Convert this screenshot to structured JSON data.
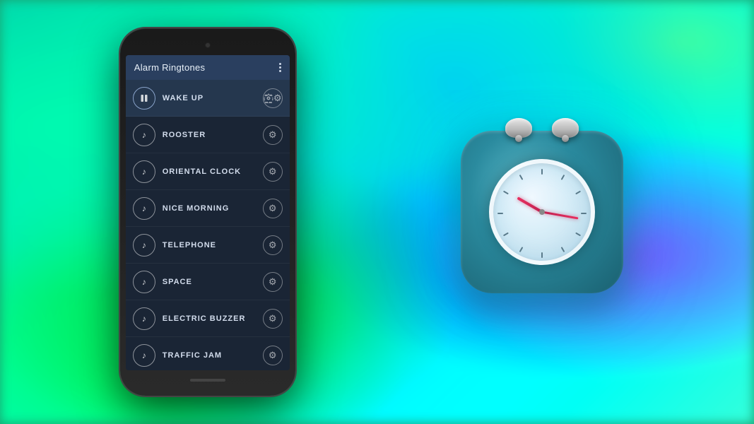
{
  "app": {
    "title": "Alarm Ringtones",
    "menu_dots_label": "more options"
  },
  "ringtones": [
    {
      "id": 1,
      "name": "WAKE UP",
      "playing": true
    },
    {
      "id": 2,
      "name": "ROOSTER",
      "playing": false
    },
    {
      "id": 3,
      "name": "ORIENTAL CLOCK",
      "playing": false
    },
    {
      "id": 4,
      "name": "NICE MORNING",
      "playing": false
    },
    {
      "id": 5,
      "name": "TELEPHONE",
      "playing": false
    },
    {
      "id": 6,
      "name": "SPACE",
      "playing": false
    },
    {
      "id": 7,
      "name": "ELECTRIC BUZZER",
      "playing": false
    },
    {
      "id": 8,
      "name": "TRAFFIC JAM",
      "playing": false
    }
  ],
  "clock_icon": {
    "alt": "Alarm Clock App Icon"
  }
}
